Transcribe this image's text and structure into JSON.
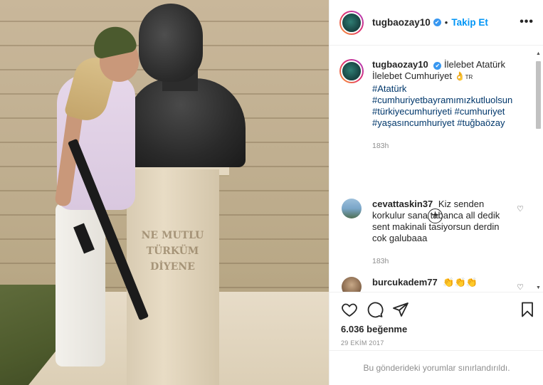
{
  "post": {
    "username": "tugbaozay10",
    "verified_mark": "✔",
    "separator": "•",
    "follow_label": "Takip Et",
    "more_label": "•••"
  },
  "photo": {
    "plaque_text": "NE MUTLU TÜRKÜM DİYENE",
    "description_icon": "photo"
  },
  "caption": {
    "username": "tugbaozay10",
    "line1": "İlelebet Atatürk",
    "line2": "İlelebet Cumhuriyet",
    "emoji": "👌",
    "flag": "TR",
    "hashtags": [
      "#Atatürk",
      "#cumhuriyetbayramımızkutluolsun",
      "#türkiyecumhuriyeti #cumhuriyet",
      "#yaşasıncumhuriyet #tuğbaözay"
    ],
    "time": "183h"
  },
  "load_more_label": "+",
  "comments": [
    {
      "username": "cevattaskin37",
      "text_first": "Kiz senden",
      "text_rest": [
        "korkulur sana tabanca all dedik",
        "sent makinali tasiyorsun derdin",
        "cok galubaaa"
      ],
      "time": "183h"
    },
    {
      "username": "burcukadem77",
      "text_first": "👏👏👏",
      "text_rest": [],
      "time": ""
    }
  ],
  "actions": {
    "likes": "6.036 beğenme",
    "date": "29 EKİM 2017"
  },
  "footer": {
    "text": "Bu gönderideki yorumlar sınırlandırıldı."
  },
  "colors": {
    "accent": "#0095f6",
    "hashtag": "#00376b",
    "muted": "#8e8e8e",
    "border": "#efefef"
  }
}
